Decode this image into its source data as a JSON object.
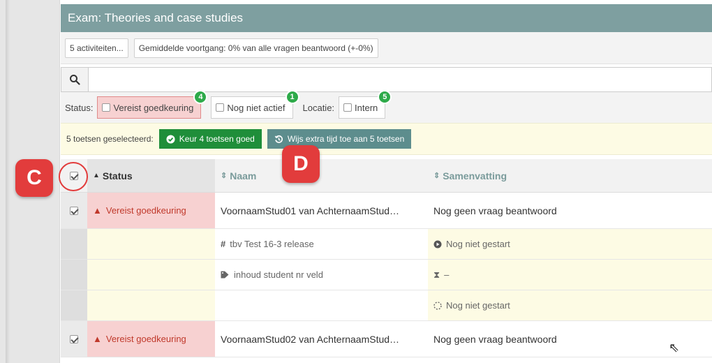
{
  "title": "Exam: Theories and case studies",
  "info": {
    "activities": "5 activiteiten...",
    "progress": "Gemiddelde voortgang: 0% van alle vragen beantwoord (+-0%)"
  },
  "search": {
    "placeholder": "",
    "value": ""
  },
  "filters": {
    "status_label": "Status:",
    "status_options": [
      {
        "label": "Vereist goedkeuring",
        "count": "4"
      },
      {
        "label": "Nog niet actief",
        "count": "1"
      }
    ],
    "location_label": "Locatie:",
    "location_options": [
      {
        "label": "Intern",
        "count": "5"
      }
    ]
  },
  "actions": {
    "selected_text": "5 toetsen geselecteerd:",
    "approve": "Keur 4 toetsen goed",
    "extra_time": "Wijs extra tijd toe aan 5 toetsen"
  },
  "table": {
    "headers": {
      "status": "Status",
      "naam": "Naam",
      "samenvatting": "Samenvatting"
    },
    "rows": [
      {
        "status": "Vereist goedkeuring",
        "naam": "VoornaamStud01 van AchternaamStud…",
        "samenvatting": "Nog geen vraag beantwoord",
        "details": [
          {
            "naam": "tbv Test 16-3 release",
            "samenvatting": "Nog niet gestart"
          },
          {
            "naam": "inhoud student nr veld",
            "samenvatting": "–"
          },
          {
            "naam": "",
            "samenvatting": "Nog niet gestart"
          }
        ]
      },
      {
        "status": "Vereist goedkeuring",
        "naam": "VoornaamStud02 van AchternaamStud…",
        "samenvatting": "Nog geen vraag beantwoord"
      }
    ]
  },
  "callouts": {
    "c": "C",
    "d": "D"
  },
  "colors": {
    "header": "#7e9fa0",
    "approve_green": "#1f8e3a",
    "badge_green": "#2eaa4a",
    "warn_red": "#c0392b",
    "callout_red": "#e23c3c"
  },
  "icons": {
    "search": "search-icon",
    "check_circle": "check-circle-icon",
    "history": "history-icon",
    "warning": "warning-icon",
    "hash": "hash-icon",
    "tag": "tag-icon",
    "play_circle": "play-circle-icon",
    "hourglass": "hourglass-icon",
    "spinner": "spinner-icon",
    "sort": "sort-icon"
  }
}
